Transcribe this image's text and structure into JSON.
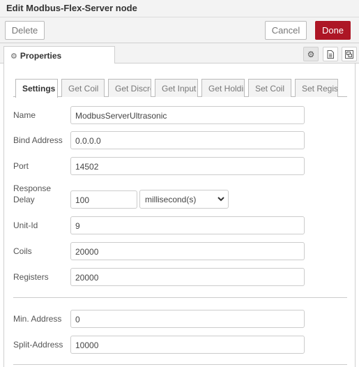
{
  "dialog": {
    "title": "Edit Modbus-Flex-Server node"
  },
  "toolbar": {
    "delete_label": "Delete",
    "cancel_label": "Cancel",
    "done_label": "Done"
  },
  "tabs": {
    "properties_label": "Properties"
  },
  "subtabs": [
    "Settings",
    "Get Coil",
    "Get Discrete Inputs",
    "Get Input Registers",
    "Get Holding Registers",
    "Set Coil",
    "Set Register"
  ],
  "fields": {
    "name": {
      "label": "Name",
      "value": "ModbusServerUltrasonic"
    },
    "bind_address": {
      "label": "Bind Address",
      "value": "0.0.0.0"
    },
    "port": {
      "label": "Port",
      "value": "14502"
    },
    "response_delay": {
      "label_line1": "Response",
      "label_line2": "Delay",
      "value": "100",
      "unit": "millisecond(s)"
    },
    "unit_id": {
      "label": "Unit-Id",
      "value": "9"
    },
    "coils": {
      "label": "Coils",
      "value": "20000"
    },
    "registers": {
      "label": "Registers",
      "value": "20000"
    },
    "min_address": {
      "label": "Min. Address",
      "value": "0"
    },
    "split_address": {
      "label": "Split-Address",
      "value": "10000"
    }
  },
  "colors": {
    "done_button": "#ad1625",
    "panel_bg": "#f3f3f3"
  }
}
